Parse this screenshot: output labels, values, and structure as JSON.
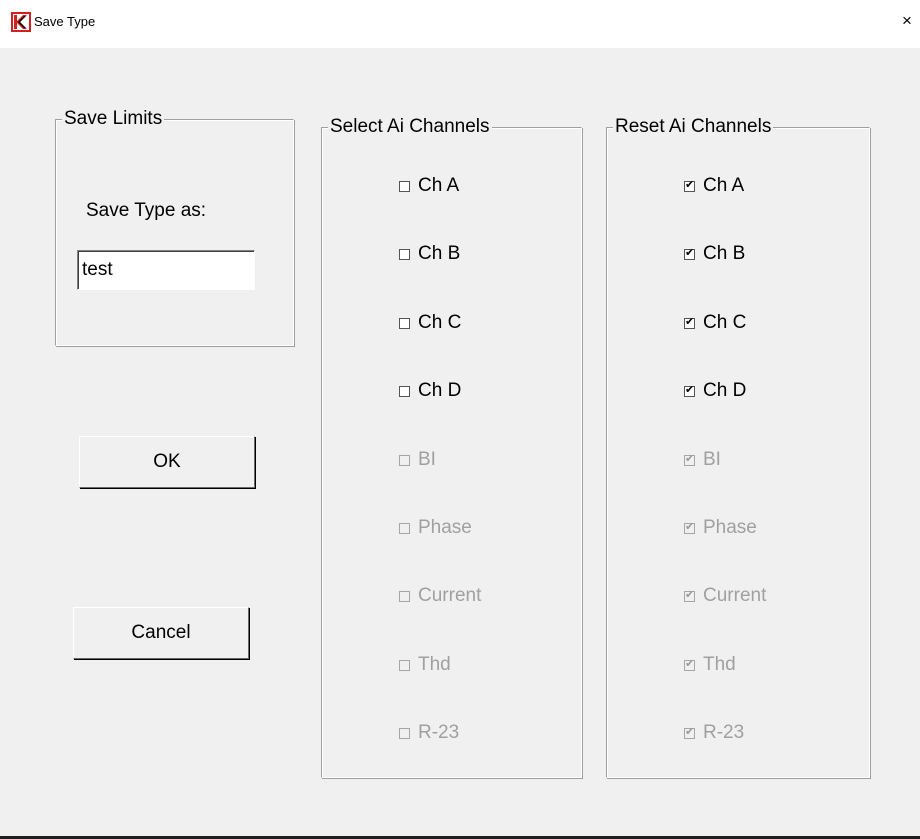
{
  "window": {
    "title": "Save Type",
    "close_glyph": "×",
    "icon": "app-logo-icon",
    "logo_colors": [
      "#d02020",
      "#000000"
    ]
  },
  "save_limits": {
    "legend": "Save  Limits",
    "label": "Save Type as:",
    "input_value": "test"
  },
  "buttons": {
    "ok": "OK",
    "cancel": "Cancel"
  },
  "select_channels": {
    "legend": "Select Ai Channels",
    "items": [
      {
        "label": "Ch A",
        "checked": false,
        "enabled": true
      },
      {
        "label": "Ch B",
        "checked": false,
        "enabled": true
      },
      {
        "label": "Ch C",
        "checked": false,
        "enabled": true
      },
      {
        "label": "Ch D",
        "checked": false,
        "enabled": true
      },
      {
        "label": "BI",
        "checked": false,
        "enabled": false
      },
      {
        "label": "Phase",
        "checked": false,
        "enabled": false
      },
      {
        "label": "Current",
        "checked": false,
        "enabled": false
      },
      {
        "label": "Thd",
        "checked": false,
        "enabled": false
      },
      {
        "label": "R-23",
        "checked": false,
        "enabled": false
      }
    ]
  },
  "reset_channels": {
    "legend": "Reset Ai Channels",
    "items": [
      {
        "label": "Ch A",
        "checked": true,
        "enabled": true
      },
      {
        "label": "Ch B",
        "checked": true,
        "enabled": true
      },
      {
        "label": "Ch C",
        "checked": true,
        "enabled": true
      },
      {
        "label": "Ch D",
        "checked": true,
        "enabled": true
      },
      {
        "label": "BI",
        "checked": true,
        "enabled": false
      },
      {
        "label": "Phase",
        "checked": true,
        "enabled": false
      },
      {
        "label": "Current",
        "checked": true,
        "enabled": false
      },
      {
        "label": "Thd",
        "checked": true,
        "enabled": false
      },
      {
        "label": "R-23",
        "checked": true,
        "enabled": false
      }
    ]
  }
}
